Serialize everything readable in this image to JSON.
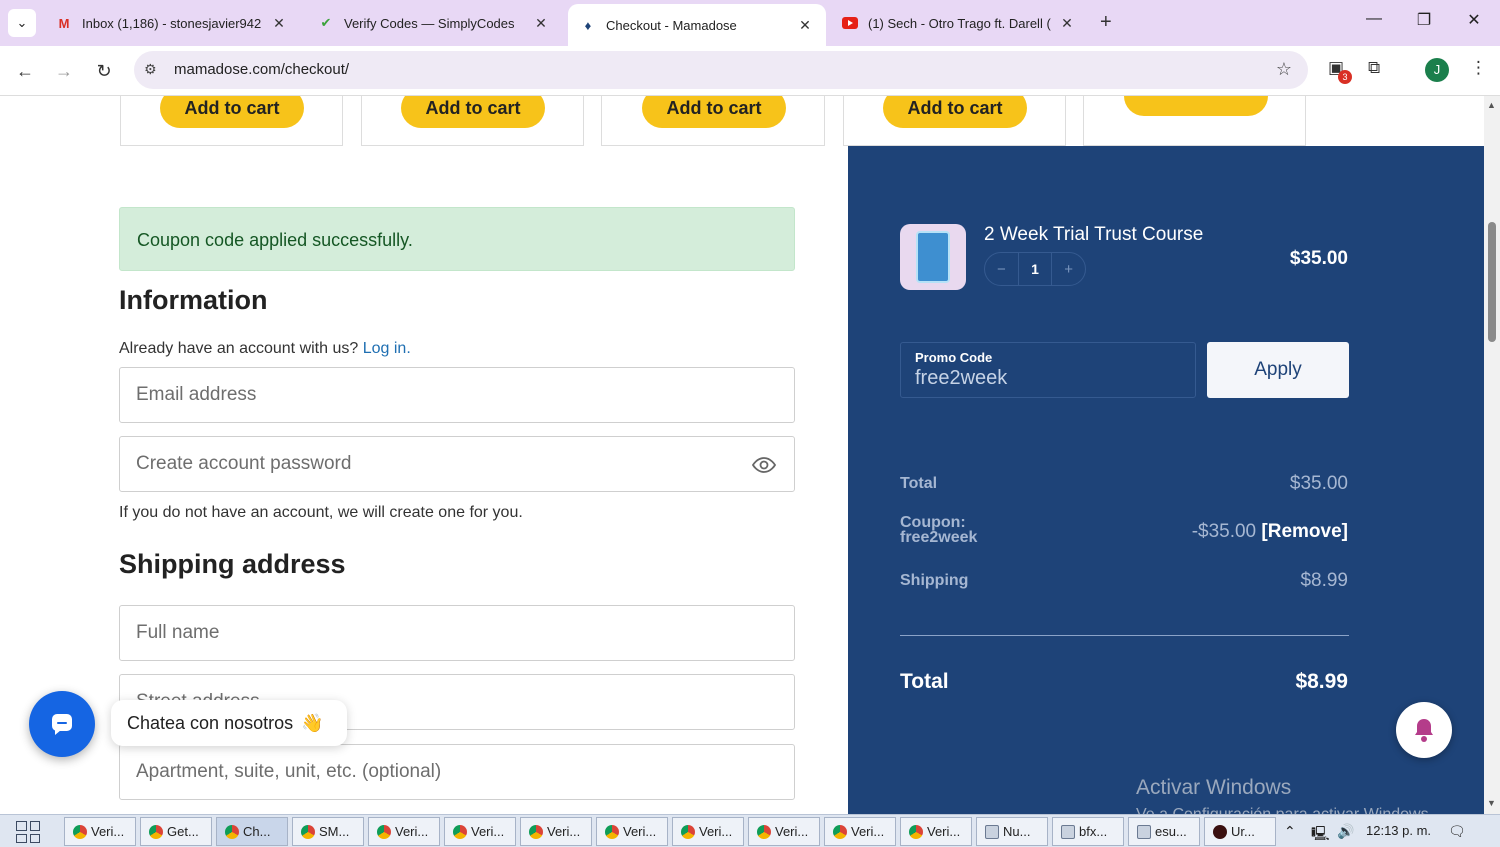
{
  "browser": {
    "tabs": [
      {
        "label": "Inbox (1,186) - stonesjavier942",
        "icon": "gmail-icon",
        "active": false
      },
      {
        "label": "Verify Codes — SimplyCodes",
        "icon": "simplycodes-icon",
        "active": false
      },
      {
        "label": "Checkout - Mamadose",
        "icon": "mamadose-icon",
        "active": true
      },
      {
        "label": "(1) Sech - Otro Trago ft. Darell (",
        "icon": "youtube-icon",
        "active": false
      }
    ],
    "url": "mamadose.com/checkout/",
    "extension_badge": "3",
    "profile_initial": "J"
  },
  "products": {
    "add_to_cart_label": "Add to cart"
  },
  "alert": {
    "text": "Coupon code applied successfully."
  },
  "information": {
    "title": "Information",
    "account_prompt": "Already have an account with us?",
    "login_link": "Log in.",
    "email_placeholder": "Email address",
    "password_placeholder": "Create account password",
    "account_note": "If you do not have an account, we will create one for you."
  },
  "shipping": {
    "title": "Shipping address",
    "fullname_placeholder": "Full name",
    "street_placeholder": "Street address",
    "apartment_placeholder": "Apartment, suite, unit, etc. (optional)"
  },
  "cart": {
    "item_name": "2 Week Trial Trust Course",
    "quantity": "1",
    "item_price": "$35.00"
  },
  "promo": {
    "label": "Promo Code",
    "value": "free2week",
    "apply_label": "Apply"
  },
  "summary": {
    "total_label": "Total",
    "total_value": "$35.00",
    "coupon_label_1": "Coupon:",
    "coupon_label_2": "free2week",
    "coupon_value": "-$35.00",
    "remove_label": "[Remove]",
    "shipping_label": "Shipping",
    "shipping_value": "$8.99",
    "grand_total_label": "Total",
    "grand_total_value": "$8.99"
  },
  "chat": {
    "bubble_text": "Chatea con nosotros"
  },
  "watermark": {
    "line1": "Activar Windows",
    "line2": "Ve a Configuración para activar Windows."
  },
  "taskbar": {
    "items": [
      "Veri...",
      "Get...",
      "Ch...",
      "SM...",
      "Veri...",
      "Veri...",
      "Veri...",
      "Veri...",
      "Veri...",
      "Veri...",
      "Veri...",
      "Veri...",
      "Nu...",
      "bfx...",
      "esu...",
      "Ur..."
    ],
    "clock": "12:13 p. m."
  },
  "colors": {
    "accent_yellow": "#f7c31a",
    "panel_blue": "#1e4378",
    "success_bg": "#d4edda",
    "link_blue": "#1f6fb2"
  }
}
